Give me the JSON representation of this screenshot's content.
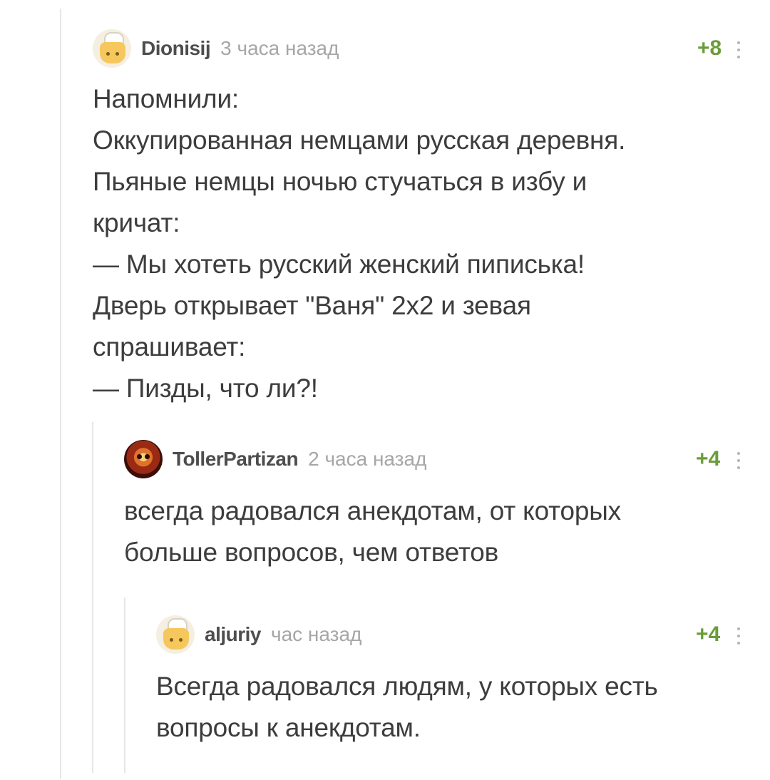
{
  "comments": [
    {
      "author": "Dionisij",
      "time": "3 часа назад",
      "rating": "+8",
      "avatar_icon": "default-cook-avatar-icon",
      "text": "Напомнили:\nОккупированная немцами русская деревня.\nПьяные немцы ночью стучаться в избу и\nкричат:\n— Мы хотеть русский женский пиписька!\nДверь открывает \"Ваня\" 2х2 и зевая\nспрашивает:\n— Пизды, что ли?!"
    },
    {
      "author": "TollerPartizan",
      "time": "2 часа назад",
      "rating": "+4",
      "avatar_icon": "flaming-skull-avatar-icon",
      "text": "всегда радовался анекдотам, от которых\nбольше вопросов, чем ответов"
    },
    {
      "author": "aljuriy",
      "time": "час назад",
      "rating": "+4",
      "avatar_icon": "default-cook-avatar-icon",
      "text": "Всегда радовался людям, у которых есть\nвопросы к анекдотам."
    }
  ],
  "colors": {
    "rating": "#6a9d3a",
    "author": "#4d4d4d",
    "time": "#a6a6a6",
    "text": "#3d3d3d",
    "thread_line": "#e6e6e6"
  }
}
